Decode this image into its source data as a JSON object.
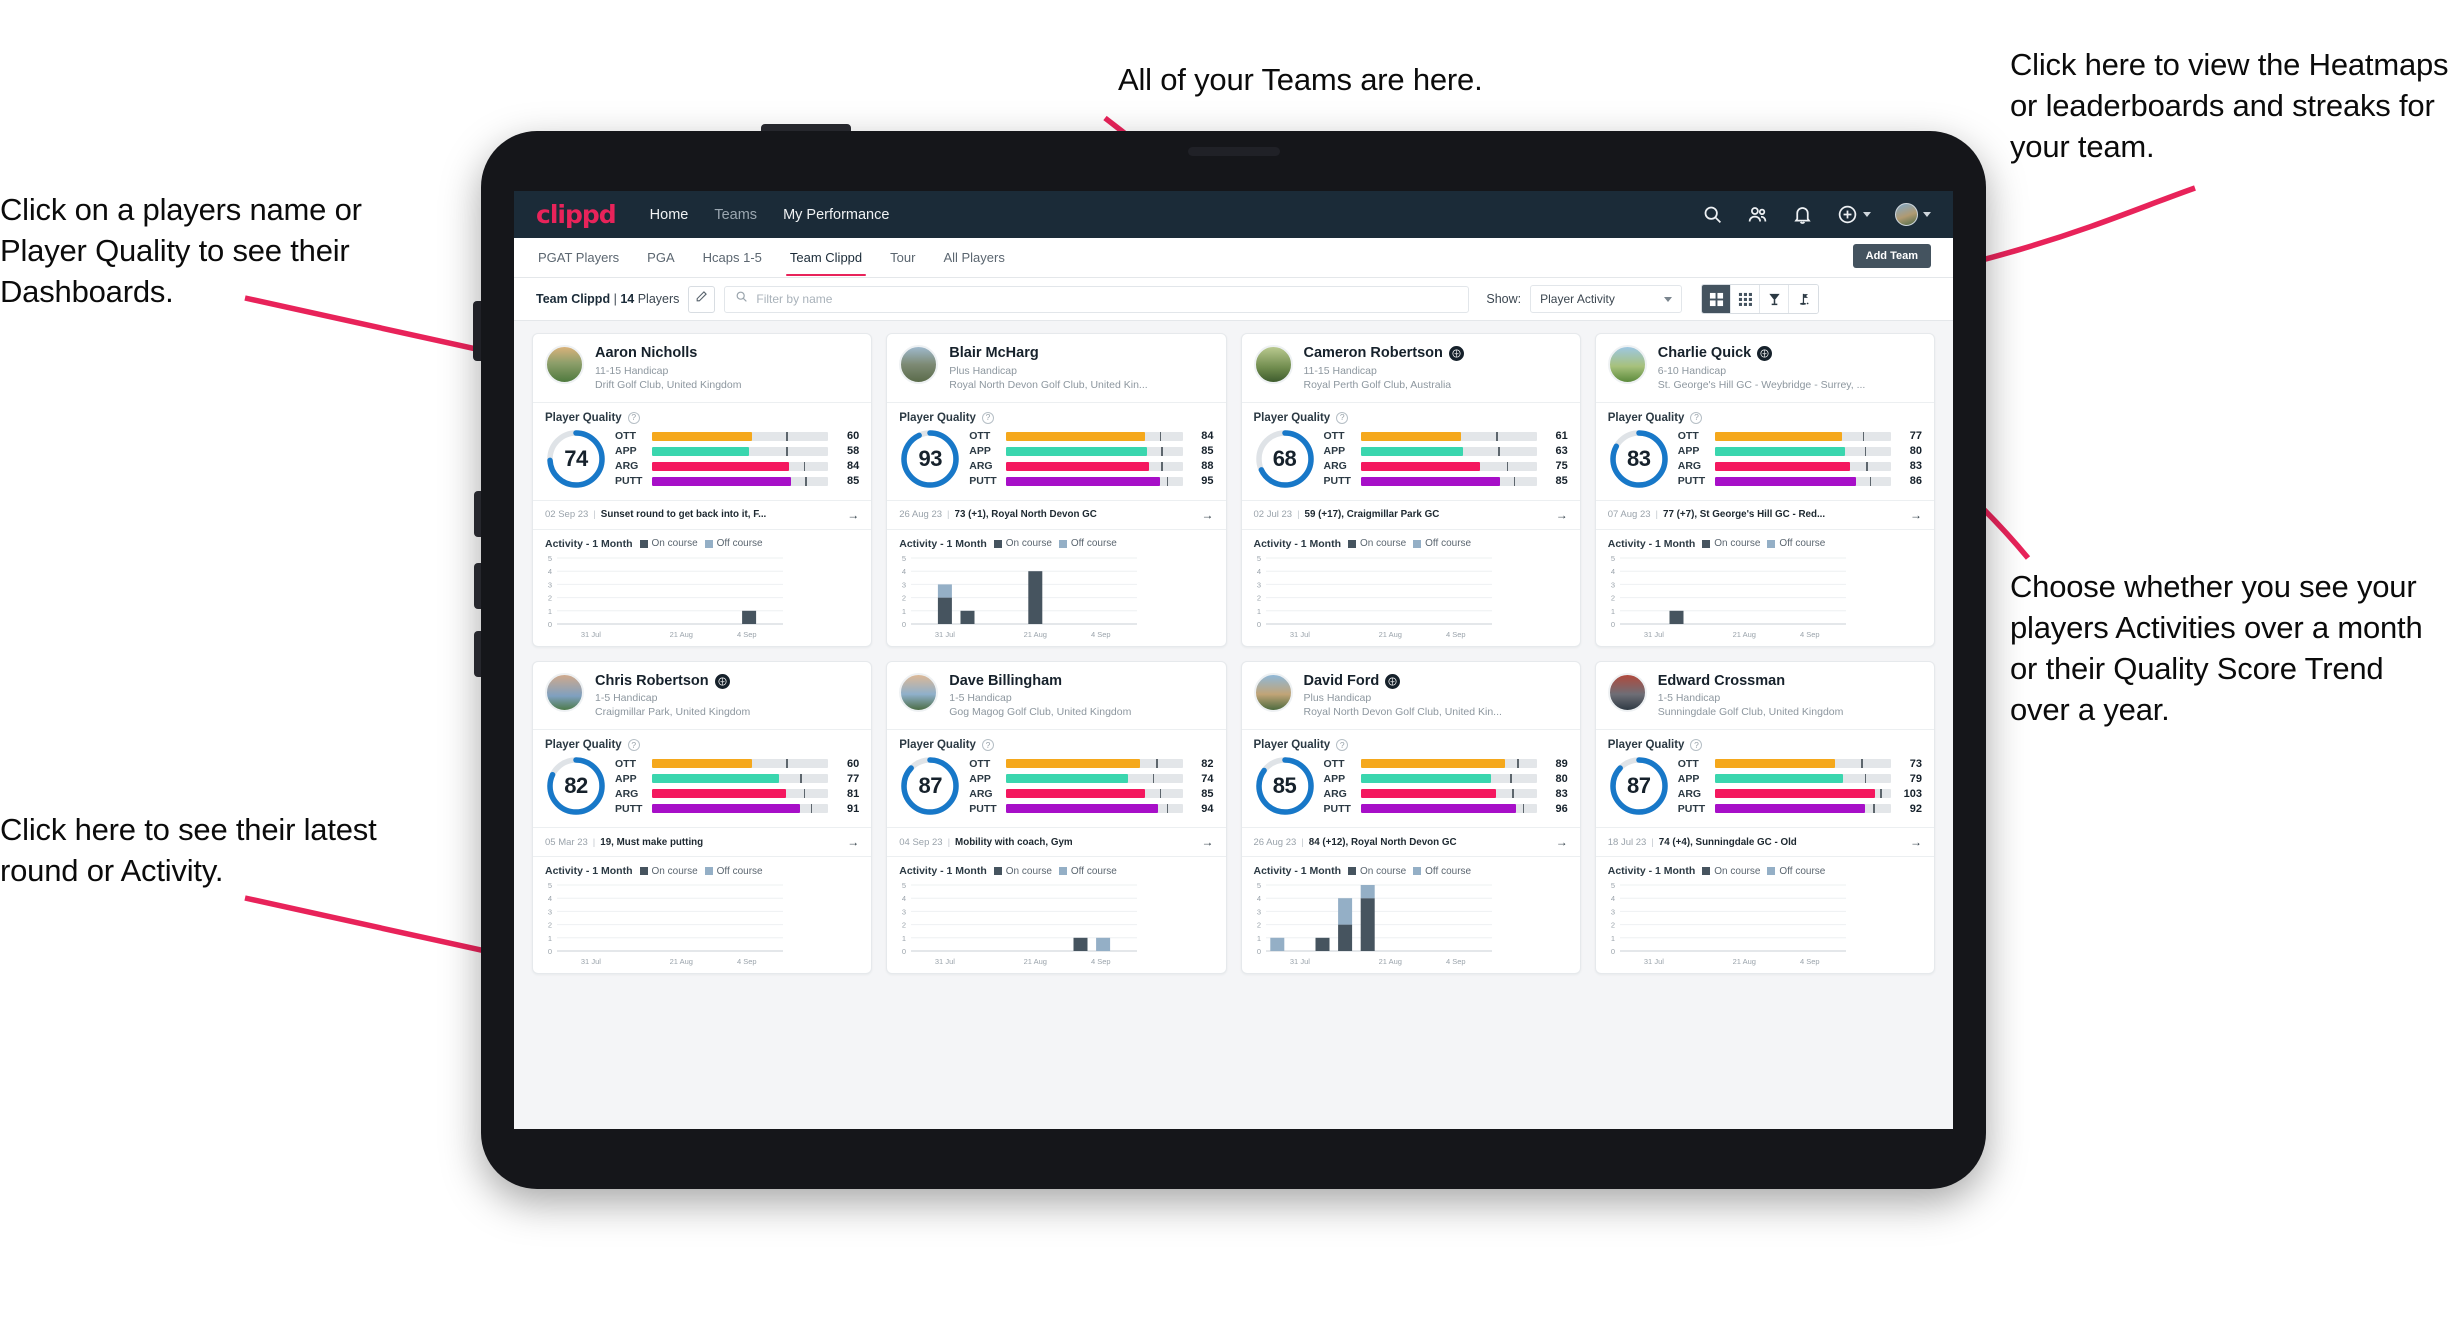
{
  "annotations": {
    "top_center": "All of your Teams are here.",
    "top_right": "Click here to view the Heatmaps or leaderboards and streaks for your team.",
    "left_top": "Click on a players name or Player Quality to see their Dashboards.",
    "right_mid": "Choose whether you see your players Activities over a month or their Quality Score Trend over a year.",
    "left_bottom": "Click here to see their latest round or Activity.",
    "arrow_color": "#e8235a"
  },
  "app": {
    "brand": "clippd",
    "nav": [
      {
        "label": "Home",
        "active": true
      },
      {
        "label": "Teams",
        "active": false
      },
      {
        "label": "My Performance",
        "active": false
      }
    ],
    "header_icons": [
      "search-icon",
      "people-icon",
      "bell-icon",
      "plus-circle-icon",
      "avatar"
    ],
    "tabs": [
      {
        "label": "PGAT Players",
        "active": false
      },
      {
        "label": "PGA",
        "active": false
      },
      {
        "label": "Hcaps 1-5",
        "active": false
      },
      {
        "label": "Team Clippd",
        "active": true
      },
      {
        "label": "Tour",
        "active": false
      },
      {
        "label": "All Players",
        "active": false
      }
    ],
    "add_team_label": "Add Team",
    "filters": {
      "team_name": "Team Clippd",
      "team_sep": "|",
      "player_count": "14",
      "players_word": "Players",
      "edit_icon": "pencil-icon",
      "search_placeholder": "Filter by name",
      "show_label": "Show:",
      "show_value": "Player Activity",
      "view_modes": [
        {
          "name": "grid-large-view",
          "active": true
        },
        {
          "name": "grid-small-view",
          "active": false
        },
        {
          "name": "trophy-leaderboard-view",
          "active": false
        },
        {
          "name": "golf-flag-heatmap-view",
          "active": false
        }
      ]
    },
    "card_labels": {
      "player_quality": "Player Quality",
      "activity": "Activity - 1 Month",
      "legend_on": "On course",
      "legend_off": "Off course",
      "metric_names": [
        "OTT",
        "APP",
        "ARG",
        "PUTT"
      ],
      "arrow": "→"
    },
    "metric_colors": {
      "OTT": "#f5a81c",
      "APP": "#3ad6ae",
      "ARG": "#f4185f",
      "PUTT": "#a70fc8"
    },
    "ring_color": "#1878c8",
    "chart_axis_labels": [
      "31 Jul",
      "21 Aug",
      "4 Sep"
    ],
    "chart_y_ticks": [
      "5",
      "4",
      "3",
      "2",
      "1",
      "0"
    ]
  },
  "players": [
    {
      "name": "Aaron Nicholls",
      "verified": false,
      "handicap": "11-15 Handicap",
      "club": "Drift Golf Club, United Kingdom",
      "quality": 74,
      "metrics": [
        {
          "label": "OTT",
          "value": 60,
          "fill_pct": 57,
          "tick_pct": 76
        },
        {
          "label": "APP",
          "value": 58,
          "fill_pct": 55,
          "tick_pct": 76
        },
        {
          "label": "ARG",
          "value": 84,
          "fill_pct": 78,
          "tick_pct": 86
        },
        {
          "label": "PUTT",
          "value": 85,
          "fill_pct": 79,
          "tick_pct": 87
        }
      ],
      "last_round_date": "02 Sep 23",
      "last_round_text": "Sunset round to get back into it, F...",
      "activity": {
        "on": [
          0,
          0,
          0,
          0,
          0,
          0,
          0,
          0,
          1,
          0
        ],
        "off": [
          0,
          0,
          0,
          0,
          0,
          0,
          0,
          0,
          0,
          0
        ]
      }
    },
    {
      "name": "Blair McHarg",
      "verified": false,
      "handicap": "Plus Handicap",
      "club": "Royal North Devon Golf Club, United Kin...",
      "quality": 93,
      "metrics": [
        {
          "label": "OTT",
          "value": 84,
          "fill_pct": 79,
          "tick_pct": 87
        },
        {
          "label": "APP",
          "value": 85,
          "fill_pct": 80,
          "tick_pct": 88
        },
        {
          "label": "ARG",
          "value": 88,
          "fill_pct": 81,
          "tick_pct": 88
        },
        {
          "label": "PUTT",
          "value": 95,
          "fill_pct": 87,
          "tick_pct": 91
        }
      ],
      "last_round_date": "26 Aug 23",
      "last_round_text": "73 (+1), Royal North Devon GC",
      "activity": {
        "on": [
          0,
          2,
          1,
          0,
          0,
          4,
          0,
          0,
          0,
          0
        ],
        "off": [
          0,
          1,
          0,
          0,
          0,
          0,
          0,
          0,
          0,
          0
        ]
      }
    },
    {
      "name": "Cameron Robertson",
      "verified": true,
      "handicap": "11-15 Handicap",
      "club": "Royal Perth Golf Club, Australia",
      "quality": 68,
      "metrics": [
        {
          "label": "OTT",
          "value": 61,
          "fill_pct": 57,
          "tick_pct": 77
        },
        {
          "label": "APP",
          "value": 63,
          "fill_pct": 58,
          "tick_pct": 78
        },
        {
          "label": "ARG",
          "value": 75,
          "fill_pct": 68,
          "tick_pct": 83
        },
        {
          "label": "PUTT",
          "value": 85,
          "fill_pct": 79,
          "tick_pct": 87
        }
      ],
      "last_round_date": "02 Jul 23",
      "last_round_text": "59 (+17), Craigmillar Park GC",
      "activity": {
        "on": [
          0,
          0,
          0,
          0,
          0,
          0,
          0,
          0,
          0,
          0
        ],
        "off": [
          0,
          0,
          0,
          0,
          0,
          0,
          0,
          0,
          0,
          0
        ]
      }
    },
    {
      "name": "Charlie Quick",
      "verified": true,
      "handicap": "6-10 Handicap",
      "club": "St. George's Hill GC - Weybridge - Surrey, ...",
      "quality": 83,
      "metrics": [
        {
          "label": "OTT",
          "value": 77,
          "fill_pct": 72,
          "tick_pct": 84
        },
        {
          "label": "APP",
          "value": 80,
          "fill_pct": 74,
          "tick_pct": 85
        },
        {
          "label": "ARG",
          "value": 83,
          "fill_pct": 77,
          "tick_pct": 86
        },
        {
          "label": "PUTT",
          "value": 86,
          "fill_pct": 80,
          "tick_pct": 88
        }
      ],
      "last_round_date": "07 Aug 23",
      "last_round_text": "77 (+7), St George's Hill GC - Red...",
      "activity": {
        "on": [
          0,
          0,
          1,
          0,
          0,
          0,
          0,
          0,
          0,
          0
        ],
        "off": [
          0,
          0,
          0,
          0,
          0,
          0,
          0,
          0,
          0,
          0
        ]
      }
    },
    {
      "name": "Chris Robertson",
      "verified": true,
      "handicap": "1-5 Handicap",
      "club": "Craigmillar Park, United Kingdom",
      "quality": 82,
      "metrics": [
        {
          "label": "OTT",
          "value": 60,
          "fill_pct": 57,
          "tick_pct": 76
        },
        {
          "label": "APP",
          "value": 77,
          "fill_pct": 72,
          "tick_pct": 84
        },
        {
          "label": "ARG",
          "value": 81,
          "fill_pct": 76,
          "tick_pct": 86
        },
        {
          "label": "PUTT",
          "value": 91,
          "fill_pct": 84,
          "tick_pct": 90
        }
      ],
      "last_round_date": "05 Mar 23",
      "last_round_text": "19, Must make putting",
      "activity": {
        "on": [
          0,
          0,
          0,
          0,
          0,
          0,
          0,
          0,
          0,
          0
        ],
        "off": [
          0,
          0,
          0,
          0,
          0,
          0,
          0,
          0,
          0,
          0
        ]
      }
    },
    {
      "name": "Dave Billingham",
      "verified": false,
      "handicap": "1-5 Handicap",
      "club": "Gog Magog Golf Club, United Kingdom",
      "quality": 87,
      "metrics": [
        {
          "label": "OTT",
          "value": 82,
          "fill_pct": 76,
          "tick_pct": 85
        },
        {
          "label": "APP",
          "value": 74,
          "fill_pct": 69,
          "tick_pct": 83
        },
        {
          "label": "ARG",
          "value": 85,
          "fill_pct": 79,
          "tick_pct": 87
        },
        {
          "label": "PUTT",
          "value": 94,
          "fill_pct": 86,
          "tick_pct": 91
        }
      ],
      "last_round_date": "04 Sep 23",
      "last_round_text": "Mobility with coach, Gym",
      "activity": {
        "on": [
          0,
          0,
          0,
          0,
          0,
          0,
          0,
          1,
          0,
          0
        ],
        "off": [
          0,
          0,
          0,
          0,
          0,
          0,
          0,
          0,
          1,
          0
        ]
      }
    },
    {
      "name": "David Ford",
      "verified": true,
      "handicap": "Plus Handicap",
      "club": "Royal North Devon Golf Club, United Kin...",
      "quality": 85,
      "metrics": [
        {
          "label": "OTT",
          "value": 89,
          "fill_pct": 82,
          "tick_pct": 89
        },
        {
          "label": "APP",
          "value": 80,
          "fill_pct": 74,
          "tick_pct": 85
        },
        {
          "label": "ARG",
          "value": 83,
          "fill_pct": 77,
          "tick_pct": 86
        },
        {
          "label": "PUTT",
          "value": 96,
          "fill_pct": 88,
          "tick_pct": 92
        }
      ],
      "last_round_date": "26 Aug 23",
      "last_round_text": "84 (+12), Royal North Devon GC",
      "activity": {
        "on": [
          0,
          0,
          1,
          2,
          4,
          0,
          0,
          0,
          0,
          0
        ],
        "off": [
          1,
          0,
          0,
          2,
          1,
          0,
          0,
          0,
          0,
          0
        ]
      }
    },
    {
      "name": "Edward Crossman",
      "verified": false,
      "handicap": "1-5 Handicap",
      "club": "Sunningdale Golf Club, United Kingdom",
      "quality": 87,
      "metrics": [
        {
          "label": "OTT",
          "value": 73,
          "fill_pct": 68,
          "tick_pct": 83
        },
        {
          "label": "APP",
          "value": 79,
          "fill_pct": 73,
          "tick_pct": 85
        },
        {
          "label": "ARG",
          "value": 103,
          "fill_pct": 91,
          "tick_pct": 94
        },
        {
          "label": "PUTT",
          "value": 92,
          "fill_pct": 85,
          "tick_pct": 90
        }
      ],
      "last_round_date": "18 Jul 23",
      "last_round_text": "74 (+4), Sunningdale GC - Old",
      "activity": {
        "on": [
          0,
          0,
          0,
          0,
          0,
          0,
          0,
          0,
          0,
          0
        ],
        "off": [
          0,
          0,
          0,
          0,
          0,
          0,
          0,
          0,
          0,
          0
        ]
      }
    }
  ]
}
